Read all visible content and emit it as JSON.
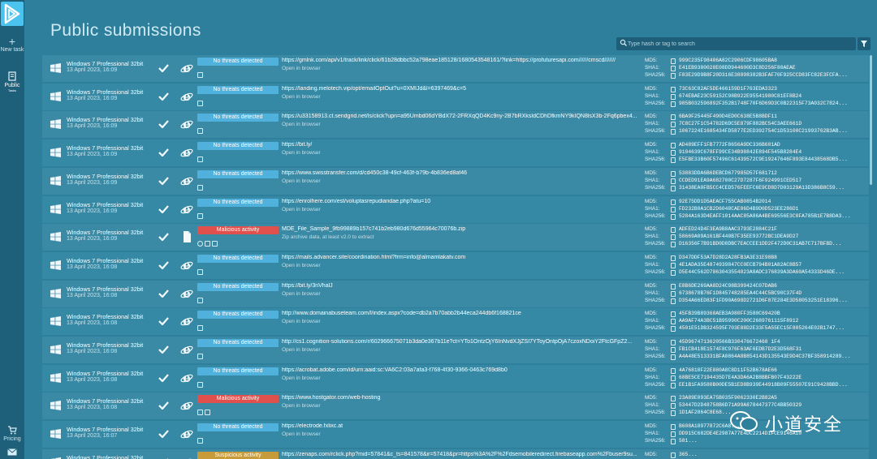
{
  "sidebar": {
    "new_task": "New task",
    "public_label": "Public",
    "public_sub": "Tasks",
    "pricing": "Pricing"
  },
  "page": {
    "title": "Public submissions"
  },
  "search": {
    "placeholder": "Type hash or tag to search"
  },
  "hash_labels": {
    "md5": "MD5:",
    "sha1": "SHA1:",
    "sha256": "SHA256:"
  },
  "rows": [
    {
      "os": "Windows 7 Professional 32bit",
      "date": "13 April 2023, 16:09",
      "verdict": "No threats detected",
      "vtype": "clean",
      "ftype": "browser",
      "target": "https://gmlnk.com/api/v1/track/link/click/61b28dbbc52a798eae185128/1680543548161/?link=https://profuturesapi.com//////cmscd///////",
      "sub": "Open in browser",
      "md5": "999C235F98406A82C2906CDF98605BA8",
      "sha1": "E41EB9380028E08DD944600D3C8D256F80AEAE",
      "sha256": "F83E29D9B8F20D316E38898382B3FAF70F925CCD83FC82E3FCFA..."
    },
    {
      "os": "Windows 7 Professional 32bit",
      "date": "13 April 2023, 16:09",
      "verdict": "No threats detected",
      "vtype": "clean",
      "ftype": "browser",
      "target": "https://landing.melotech.vip/opt/emailOptOut?u=0XMIJd&l=6397469&c=5",
      "sub": "Open in browser",
      "md5": "73C63C82AF5DE466159D1F763EDA3323",
      "sha1": "674EBAE23C59152C98B922E95541980C81EF8B24",
      "sha256": "985B032596892F352B1748F70F6D69D3C0B22315F73A032C7824..."
    },
    {
      "os": "Windows 7 Professional 32bit",
      "date": "13 April 2023, 16:09",
      "verdict": "No threats detected",
      "vtype": "clean",
      "ftype": "browser",
      "target": "https://u33158913.ct.sendgrid.net/ls/click?upn=a95Umbd06dYBdX72-2FRXqQD4Kc9ny-2B7bRXksIdCDhDfkmNY9kIQN8lsX3b-2Fq6pbex4...",
      "sub": "Open in browser",
      "md5": "6BA9F25445F490D4ED0C638E5B8BDF11",
      "sha1": "7C8C27F1C54782D6DC5E879F882BC54C3AEE661D",
      "sha256": "1067224E1685434FD5877E2ED392754C1D53100C21993762B3AB..."
    },
    {
      "os": "Windows 7 Professional 32bit",
      "date": "13 April 2023, 16:09",
      "verdict": "No threats detected",
      "vtype": "clean",
      "ftype": "browser",
      "target": "https://bit.ly/",
      "sub": "Open in browser",
      "md5": "AD489EFF1FB7772F8656A9DC336B601AD",
      "sha1": "9104639C678FF99CE34B98842E894F545B8284E4",
      "sha256": "E5FBE33B60F57496C61439572C9E19247646F893E84438568DB5..."
    },
    {
      "os": "Windows 7 Professional 32bit",
      "date": "13 April 2023, 16:09",
      "verdict": "No threats detected",
      "vtype": "clean",
      "ftype": "browser",
      "target": "https://www.swisstransfer.com/d/cd450c38-49cf-463f-b79b-4b836ed8af46",
      "sub": "Open in browser",
      "md5": "53883DDA6B6DEBCD677985D57F681712",
      "sha1": "CCDED91EA9A682700C27D7287F6F924991CED517",
      "sha256": "31438EA0FB5CC4CED576FEEFC6E9CD8D7D03129A13D386B8C59..."
    },
    {
      "os": "Windows 7 Professional 32bit",
      "date": "13 April 2023, 16:09",
      "verdict": "No threats detected",
      "vtype": "clean",
      "ftype": "browser",
      "target": "https://enrolhere.com/est/voluptasrepudiandae.php?atu=10",
      "sub": "Open in browser",
      "md5": "92E75DD1D5AEACF755CAB0854B2014",
      "sha1": "FD232B0A1CB2D6048CAE06D4B9D0D523EE286D1",
      "sha256": "5284A163D4EAFF1014AAC85A86A4BE69556E3C0FA785B1E7B8DA3..."
    },
    {
      "os": "Windows 7 Professional 32bit",
      "date": "13 April 2023, 16:09",
      "verdict": "Malicious activity",
      "vtype": "mal",
      "ftype": "file",
      "target": "MDE_File_Sample_9fb99889b157c741b2eb980d676d55964c70076b.zip",
      "sub": "Zip archive data, at least v2.0 to extract",
      "md5": "ADFED24D4F3EA9B8AAC3793E2884C21F",
      "sha1": "58669A09A161BF440B7F35EE93772BC1DEA9D27",
      "sha256": "D16356F7B91BD0D8DBC7EACCEE1DD2F472D0C31AB7C717BFBD..."
    },
    {
      "os": "Windows 7 Professional 32bit",
      "date": "13 April 2023, 16:08",
      "verdict": "No threats detected",
      "vtype": "clean",
      "ftype": "browser",
      "target": "https://mails.advancer.site/coordination.html?frm=info@almamlakatv.com",
      "sub": "Open in browser",
      "md5": "D347DDF53A7D28D2A28FB3A3E31E98B8",
      "sha1": "4E1ADA35E4874939847CC0ECB794B01A82AC8B57",
      "sha256": "D5E44C562D7863043554823A8ADC376839A3DA60A54333D46DE..."
    },
    {
      "os": "Windows 7 Professional 32bit",
      "date": "13 April 2023, 16:08",
      "verdict": "No threats detected",
      "vtype": "clean",
      "ftype": "browser",
      "target": "https://bit.ly/3nVhalJ",
      "sub": "Open in browser",
      "md5": "E8B6DE269AA8D24C98B399424C07DAB6",
      "sha1": "6738678B76F1D845748285EA4C44C5BC90C37F4D",
      "sha256": "D354A66ED83F1FD90A698D2721D6F87E284E3D58053251E18396..."
    },
    {
      "os": "Windows 7 Professional 32bit",
      "date": "13 April 2023, 16:08",
      "verdict": "No threats detected",
      "vtype": "clean",
      "ftype": "browser",
      "target": "http://www.domainabuseteam.com/l/index.aspx?code=db2a7b70abb2b44eca244db6f168821ce",
      "sub": "Open in browser",
      "md5": "45FB39B89368AEB3A980FF3580C69420B",
      "sha1": "AA9AF74A3BC51B95990C200C2689761115F8912",
      "sha256": "4501E51DB324595F703E88D2E33F5A55EC15F805264E02B1747..."
    },
    {
      "os": "Windows 7 Professional 32bit",
      "date": "13 April 2023, 16:08",
      "verdict": "No threats detected",
      "vtype": "clean",
      "ftype": "browser",
      "target": "http://cs1.cognition-solutions.com/r/602966675071b3da0e367b11e?ct=YTo1OntzOjY6InNvdXJjZSI7YToyOntpOjA7czoxNDoiY2FtcGFpZ2...",
      "sub": "Open in browser",
      "md5": "45D9674713620566B330476672468 1F4",
      "sha1": "FB1CB418E1574F8C976F63AF6EDB7D2E3D568F31",
      "sha256": "A4A48E513331BFA0864A8B854143D135543E9D4C37BF358914289..."
    },
    {
      "os": "Windows 7 Professional 32bit",
      "date": "13 April 2023, 16:08",
      "verdict": "No threats detected",
      "vtype": "clean",
      "ftype": "browser",
      "target": "https://acrobat.adobe.com/id/urn:aaid:sc:VA6C2:03a7afa3-f768-4f30-9366-0463c769d8b0",
      "sub": "Open in browser",
      "md5": "4A76818F22E880A8C8D11F52B678AE66",
      "sha1": "68BE5CE7194435D7E4A3DA6A2B8BBFB07F43222E",
      "sha256": "EE1B1FA9580B00DE5B1ED8B939E44918B09F55507E91C9428BBD..."
    },
    {
      "os": "Windows 7 Professional 32bit",
      "date": "13 April 2023, 16:08",
      "verdict": "Malicious activity",
      "vtype": "mal",
      "ftype": "browser",
      "target": "https://www.hostgator.com/web-hosting",
      "sub": "Open in browser",
      "md5": "23A89E093EA75B035F9062330E2B82A5",
      "sha1": "53447D2D48758B6D71A99A878447377C4BB50329",
      "sha256": "1D1AF2864C8E68..."
    },
    {
      "os": "Windows 7 Professional 32bit",
      "date": "13 April 2023, 16:07",
      "verdict": "No threats detected",
      "vtype": "clean",
      "ftype": "browser",
      "target": "https://electrode.fxlixc.at",
      "sub": "Open in browser",
      "md5": "B608A18977872C6A8...",
      "sha1": "DD915C682DE4E2987A77E4DC2214D1FCE9146A10",
      "sha256": "581..."
    },
    {
      "os": "Windows 7 Professional 32bit",
      "date": "13 April 2023, 16:07",
      "verdict": "Suspicious activity",
      "vtype": "susp",
      "ftype": "browser",
      "target": "https://zenaps.com/rclick.php?mid=57841&c_ts=841578&ir=57418&pr=https%3A%2F%2Fdsemobileredirect.firebaseapp.com%2Fbuser9su...",
      "sub": "Open in browser",
      "md5": "365...",
      "sha1": "",
      "sha256": ""
    }
  ],
  "watermark": {
    "text": "小道安全"
  }
}
